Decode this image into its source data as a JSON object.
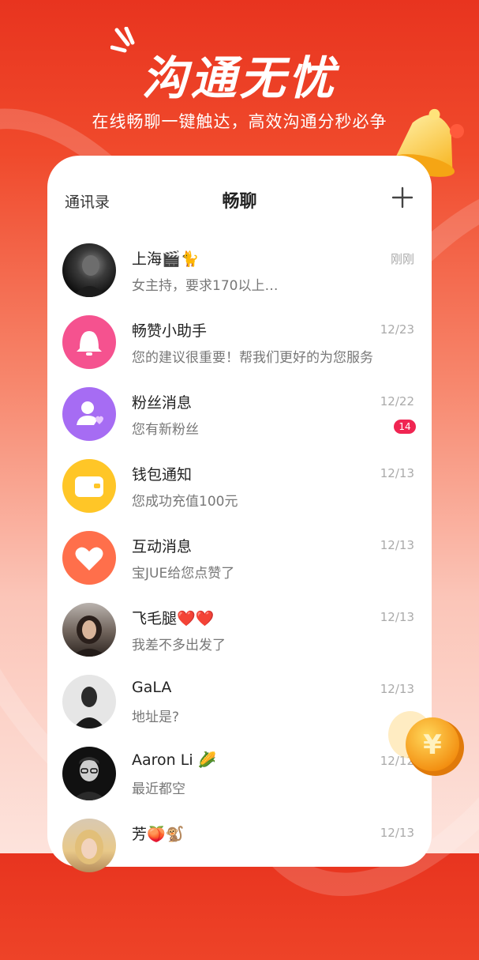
{
  "hero": {
    "title": "沟通无忧",
    "subtitle": "在线畅聊一键触达，高效沟通分秒必争"
  },
  "header": {
    "left_label": "通讯录",
    "title": "畅聊",
    "add_icon": "plus-icon"
  },
  "colors": {
    "accent": "#ef3b23",
    "badge": "#f02552"
  },
  "conversations": [
    {
      "name": "上海🎬🐈",
      "preview": "女主持，要求170以上…",
      "time": "刚刚",
      "avatar": "photo-man-dark"
    },
    {
      "name": "畅赞小助手",
      "preview": "您的建议很重要！帮我们更好的为您服务",
      "time": "12/23",
      "avatar": "bell-icon",
      "color": "#f5528f"
    },
    {
      "name": "粉丝消息",
      "preview": "您有新粉丝",
      "time": "12/22",
      "badge": "14",
      "avatar": "fan-icon",
      "color": "#a66cf3"
    },
    {
      "name": "钱包通知",
      "preview": "您成功充值100元",
      "time": "12/13",
      "avatar": "wallet-icon",
      "color": "#ffc627"
    },
    {
      "name": "互动消息",
      "preview": "宝JUE给您点赞了",
      "time": "12/13",
      "avatar": "heart-icon",
      "color": "#ff6f4b"
    },
    {
      "name": "飞毛腿❤️❤️",
      "preview": "我差不多出发了",
      "time": "12/13",
      "avatar": "photo-woman-dark-hair"
    },
    {
      "name": "GaLA",
      "preview": "地址是?",
      "time": "12/13",
      "avatar": "photo-man-bw"
    },
    {
      "name": "Aaron Li 🌽",
      "preview": "最近都空",
      "time": "12/12",
      "avatar": "photo-man-glasses"
    },
    {
      "name": "芳🍑🐒",
      "preview": "",
      "time": "12/13",
      "avatar": "photo-woman-blonde"
    }
  ]
}
